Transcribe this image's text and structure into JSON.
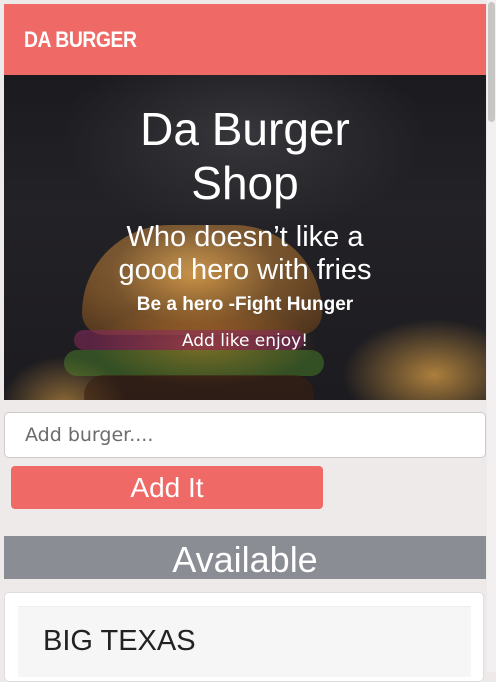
{
  "navbar": {
    "brand": "DA BURGER"
  },
  "hero": {
    "title_line1": "Da Burger",
    "title_line2": "Shop",
    "subtitle_line1": "Who doesn’t like a",
    "subtitle_line2": "good hero with fries",
    "tagline": "Be a hero -Fight Hunger",
    "note": "Add like enjoy!"
  },
  "form": {
    "placeholder": "Add burger....",
    "value": "",
    "button_label": "Add It"
  },
  "available": {
    "heading": "Available",
    "items": [
      {
        "name": "BIG TEXAS"
      }
    ]
  },
  "colors": {
    "accent": "#ef6a66",
    "section_bar": "#8b8d95",
    "background": "#eeeaea"
  }
}
